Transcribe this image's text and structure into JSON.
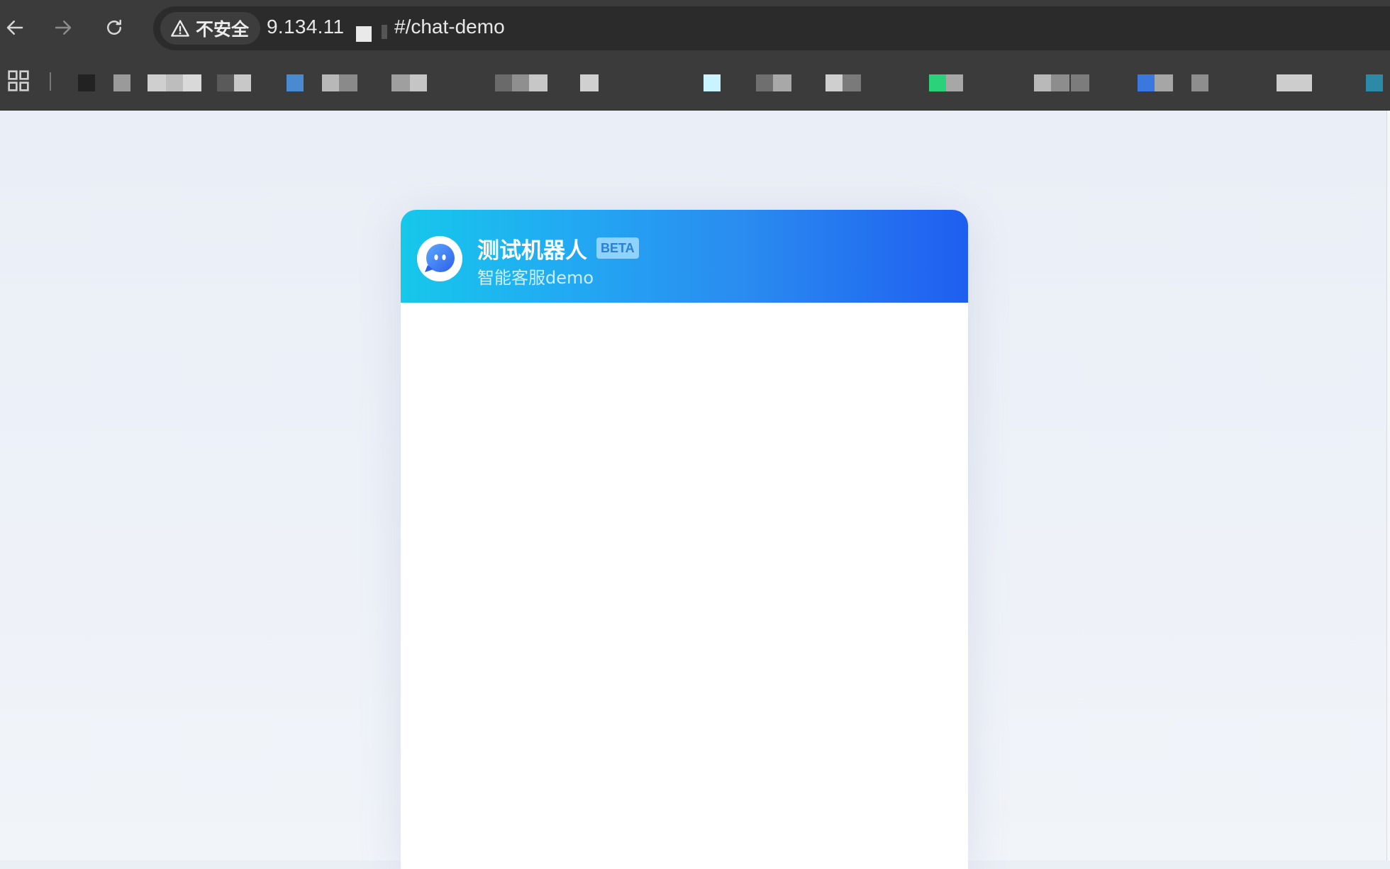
{
  "browser": {
    "security_label": "不安全",
    "url_host": "9.134.11",
    "url_path": "#/chat-demo"
  },
  "bookmarks": [
    {
      "color": "#222222"
    },
    {
      "color": "#9a9a9a"
    },
    {
      "color": "#cfcfcf"
    },
    {
      "color": "#bdbdbd"
    },
    {
      "color": "#d9d9d9"
    },
    {
      "color": "#5a5a5a"
    },
    {
      "color": "#c8c8c8"
    },
    {
      "color": "#4a8ad0"
    },
    {
      "color": "#b8b8b8"
    },
    {
      "color": "#8a8a8a"
    },
    {
      "color": "#9f9f9f"
    },
    {
      "color": "#c5c5c5"
    },
    {
      "color": "#6a6a6a"
    },
    {
      "color": "#8f8f8f"
    },
    {
      "color": "#c7c7c7"
    },
    {
      "color": "#d0d0d0"
    },
    {
      "color": "#c9f3ff"
    },
    {
      "color": "#6f6f6f"
    },
    {
      "color": "#a8a8a8"
    },
    {
      "color": "#cfcfcf"
    },
    {
      "color": "#7a7a7a"
    },
    {
      "color": "#2bd27a"
    },
    {
      "color": "#a7a7a7"
    },
    {
      "color": "#b9b9b9"
    },
    {
      "color": "#8d8d8d"
    },
    {
      "color": "#7c7c7c"
    },
    {
      "color": "#3a78e0"
    },
    {
      "color": "#a6a6a6"
    },
    {
      "color": "#8e8e8e"
    },
    {
      "color": "#cdcdcd"
    },
    {
      "color": "#2d8aa6"
    }
  ],
  "chat": {
    "bot_name": "测试机器人",
    "badge": "BETA",
    "subtitle": "智能客服demo",
    "header_gradient": [
      "#16c8ea",
      "#1f5ef0"
    ],
    "avatar_color": "#3a7bf0"
  }
}
